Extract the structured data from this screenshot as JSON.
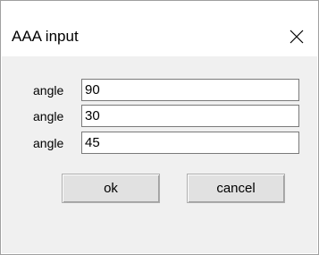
{
  "window": {
    "title": "AAA input",
    "close_glyph": "×"
  },
  "form": {
    "rows": [
      {
        "label": "angle",
        "value": "90"
      },
      {
        "label": "angle",
        "value": "30"
      },
      {
        "label": "angle",
        "value": "45"
      }
    ]
  },
  "buttons": {
    "ok_label": "ok",
    "cancel_label": "cancel"
  },
  "icons": {
    "close": "close-icon"
  },
  "colors": {
    "client_background": "#f0f0f0",
    "field_border": "#7a7a7a",
    "button_face": "#e1e1e1"
  }
}
